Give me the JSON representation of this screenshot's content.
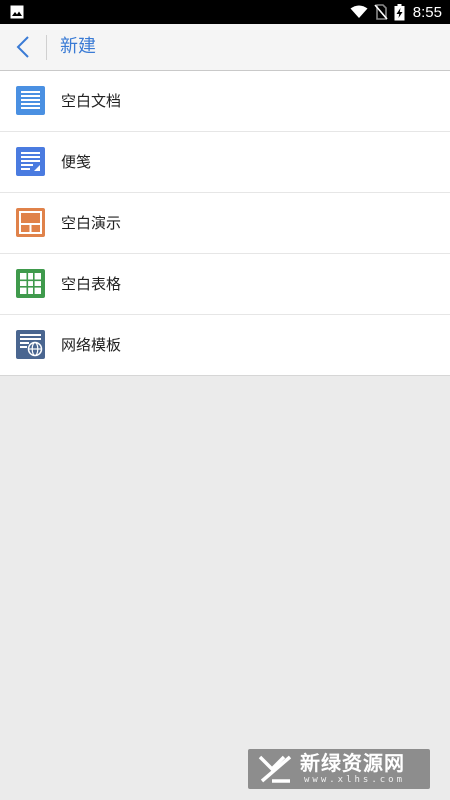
{
  "status_bar": {
    "time": "8:55",
    "icons": [
      "gallery-icon",
      "wifi-icon",
      "no-sim-icon",
      "battery-charging-icon"
    ]
  },
  "header": {
    "title": "新建",
    "back_icon": "chevron-left-icon"
  },
  "items": [
    {
      "label": "空白文档",
      "icon": "document-icon",
      "color": "#4a90e2"
    },
    {
      "label": "便笺",
      "icon": "note-icon",
      "color": "#4a7be0"
    },
    {
      "label": "空白演示",
      "icon": "presentation-icon",
      "color": "#e0824a"
    },
    {
      "label": "空白表格",
      "icon": "spreadsheet-icon",
      "color": "#3f9a4c"
    },
    {
      "label": "网络模板",
      "icon": "web-template-icon",
      "color": "#4a6690"
    }
  ],
  "watermark": {
    "name": "新绿资源网",
    "url": "www.xlhs.com"
  },
  "colors": {
    "accent": "#3a7bd5",
    "background": "#ebebeb",
    "header_bg": "#f5f5f5"
  }
}
